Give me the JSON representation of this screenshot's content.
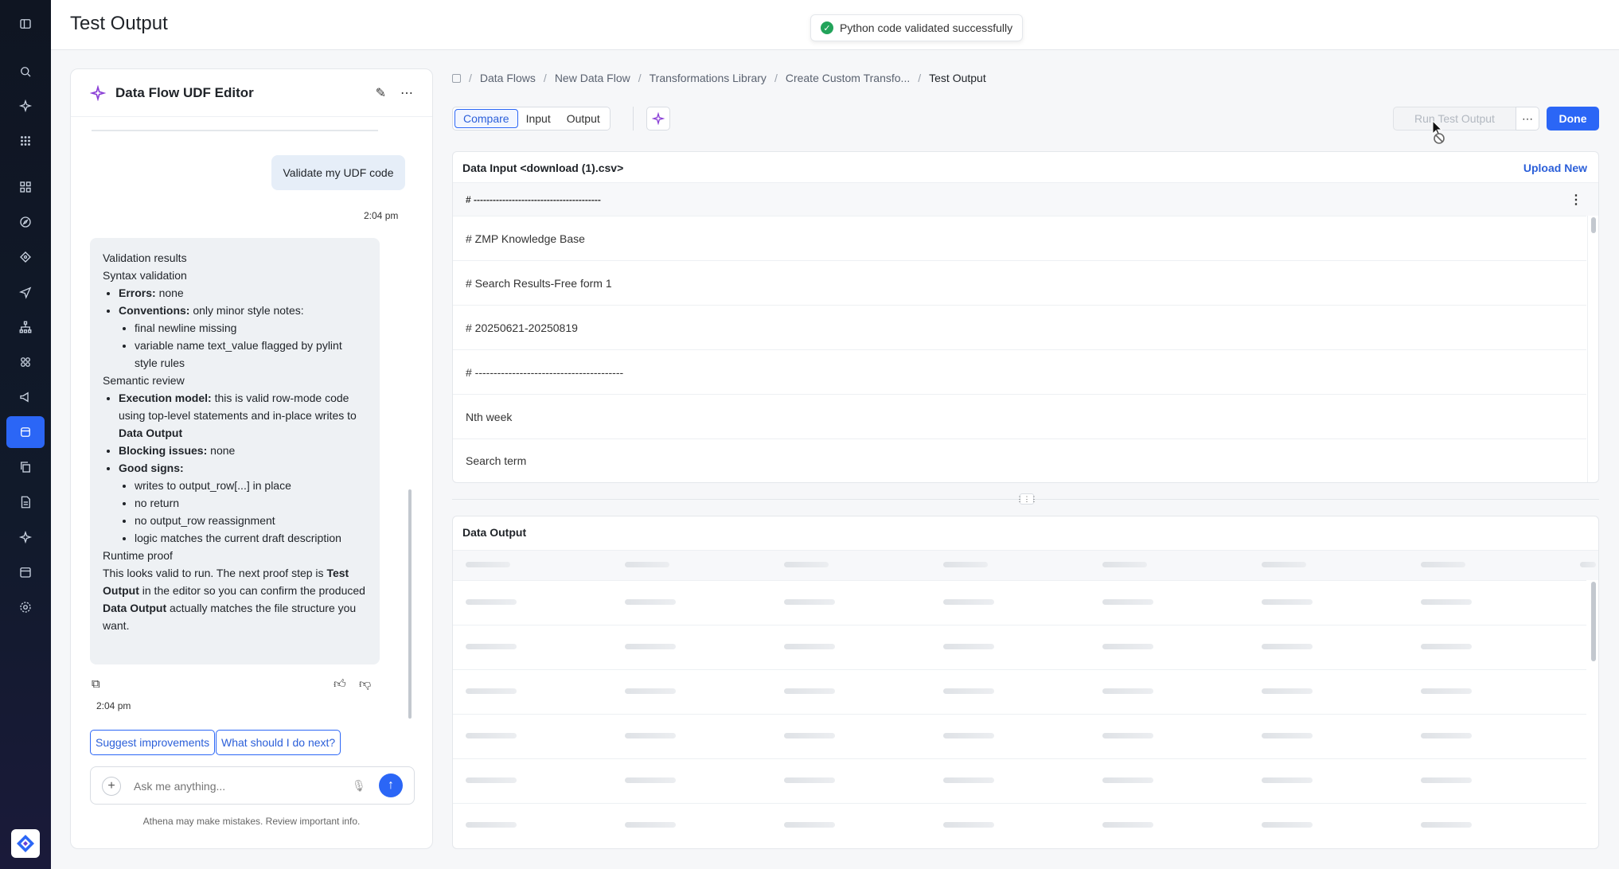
{
  "app": {
    "page_title": "Test Output"
  },
  "toast": {
    "message": "Python code validated successfully"
  },
  "rail": {
    "icons": [
      "collapse-icon",
      "search-icon",
      "sparkle-icon",
      "apps-grid-icon",
      "dashboard-icon",
      "compass-icon",
      "target-icon",
      "send-icon",
      "hierarchy-icon",
      "component-icon",
      "megaphone-icon",
      "database-icon",
      "copy-docs-icon",
      "document-icon",
      "ai-star-icon",
      "calendar-icon",
      "settings-icon"
    ],
    "active": "database-icon"
  },
  "chat": {
    "title": "Data Flow UDF Editor",
    "user_message": "Validate my UDF code",
    "user_time": "2:04 pm",
    "ai": {
      "validation_results": "Validation results",
      "syntax_validation": "Syntax validation",
      "errors_label": "Errors:",
      "errors_value": "none",
      "conventions_label": "Conventions:",
      "conventions_value": "only minor style notes:",
      "conv_1": "final newline missing",
      "conv_2": "variable name text_value flagged by pylint style rules",
      "semantic_review": "Semantic review",
      "exec_label": "Execution model:",
      "exec_value_1": "this is valid row-mode code using top-level statements and in-place writes to",
      "exec_value_2": "Data Output",
      "blocking_label": "Blocking issues:",
      "blocking_value": "none",
      "good_label": "Good signs:",
      "good_1": "writes to output_row[...] in place",
      "good_2": "no return",
      "good_3": "no output_row reassignment",
      "good_4": "logic matches the current draft description",
      "runtime_proof": "Runtime proof",
      "proof_1": "This looks valid to run. The next proof step is",
      "proof_b1": "Test Output",
      "proof_2": "in the editor so you can confirm the produced",
      "proof_b2": "Data Output",
      "proof_3": "actually matches the file structure you want."
    },
    "ai_time": "2:04 pm",
    "suggestions": [
      "Suggest improvements",
      "What should I do next?"
    ],
    "input_placeholder": "Ask me anything...",
    "disclaimer": "Athena may make mistakes. Review important info."
  },
  "breadcrumb": [
    "Data Flows",
    "New Data Flow",
    "Transformations Library",
    "Create Custom Transfo...",
    "Test Output"
  ],
  "view_tabs": [
    "Compare",
    "Input",
    "Output"
  ],
  "active_tab": "Compare",
  "toolbar": {
    "run_label": "Run Test Output",
    "done_label": "Done"
  },
  "data_input": {
    "title": "Data Input <download (1).csv>",
    "upload_label": "Upload New",
    "header_cell": "# ----------------------------------------",
    "rows": [
      "# ZMP Knowledge Base",
      "# Search Results-Free form 1",
      "# 20250621-20250819",
      "# ----------------------------------------",
      "Nth week",
      "Search term"
    ]
  },
  "data_output": {
    "title": "Data Output",
    "state": "loading"
  },
  "colors": {
    "accent": "#2b66f6",
    "rail_bg": "#111a2b",
    "success": "#22a35a"
  }
}
